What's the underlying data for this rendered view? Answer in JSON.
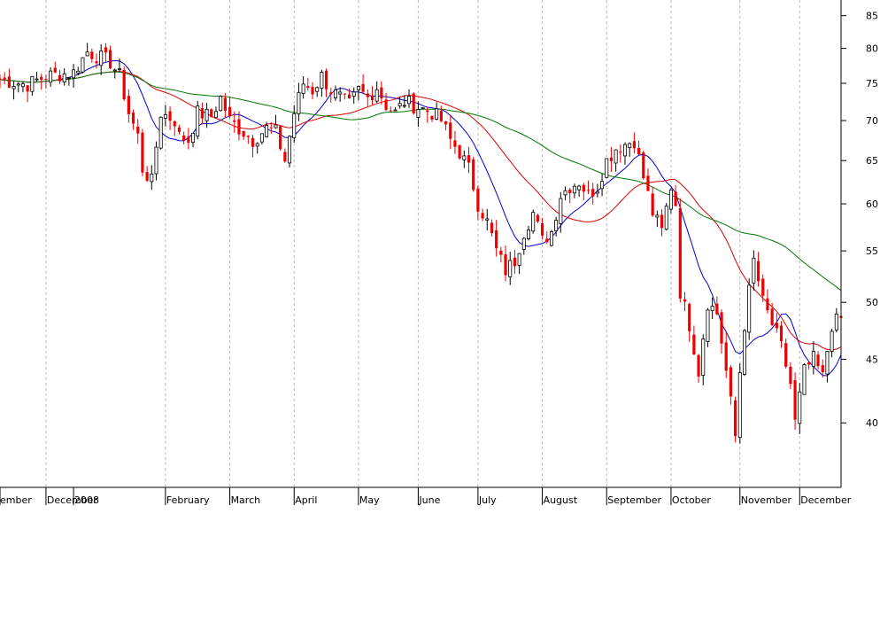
{
  "chart_data": {
    "type": "candlestick",
    "title": "",
    "xlabel": "",
    "ylabel": "",
    "y_scale": "log",
    "ylim": [
      35.5,
      87.5
    ],
    "y_ticks": [
      85,
      80,
      75,
      70,
      65,
      60,
      55,
      50,
      45,
      40
    ],
    "x_tick_labels": [
      "ember",
      "December",
      "2008",
      "February",
      "March",
      "April",
      "May",
      "June",
      "July",
      "August",
      "September",
      "October",
      "November",
      "December"
    ],
    "x_tick_index": [
      0,
      10,
      16,
      36,
      50,
      64,
      78,
      91,
      104,
      118,
      132,
      146,
      161,
      174
    ],
    "x_tick_gridline": [
      false,
      true,
      false,
      true,
      true,
      true,
      true,
      true,
      true,
      true,
      true,
      true,
      true,
      true
    ],
    "n_days": 184,
    "anchors": [
      [
        0,
        75.5
      ],
      [
        6,
        74.8
      ],
      [
        10,
        76
      ],
      [
        16,
        76.5
      ],
      [
        19,
        79.5
      ],
      [
        24,
        78
      ],
      [
        26,
        76
      ],
      [
        28,
        71
      ],
      [
        30,
        68
      ],
      [
        31,
        64
      ],
      [
        33,
        62.5
      ],
      [
        35,
        71
      ],
      [
        38,
        70
      ],
      [
        39,
        68
      ],
      [
        41,
        67.5
      ],
      [
        43,
        71
      ],
      [
        46,
        70.5
      ],
      [
        48,
        73
      ],
      [
        50,
        70
      ],
      [
        52,
        69
      ],
      [
        55,
        67.5
      ],
      [
        58,
        69
      ],
      [
        60,
        68.5
      ],
      [
        62,
        65
      ],
      [
        64,
        71
      ],
      [
        66,
        75
      ],
      [
        68,
        74
      ],
      [
        70,
        76
      ],
      [
        72,
        74
      ],
      [
        74,
        73
      ],
      [
        76,
        72
      ],
      [
        78,
        74
      ],
      [
        80,
        73
      ],
      [
        82,
        74.5
      ],
      [
        84,
        72
      ],
      [
        86,
        71
      ],
      [
        88,
        72.5
      ],
      [
        90,
        72
      ],
      [
        92,
        71.5
      ],
      [
        94,
        71
      ],
      [
        96,
        70
      ],
      [
        98,
        67.5
      ],
      [
        100,
        66
      ],
      [
        102,
        64
      ],
      [
        104,
        60
      ],
      [
        106,
        58
      ],
      [
        108,
        55
      ],
      [
        110,
        53
      ],
      [
        112,
        54
      ],
      [
        114,
        57
      ],
      [
        116,
        59
      ],
      [
        118,
        56
      ],
      [
        120,
        57
      ],
      [
        122,
        61
      ],
      [
        124,
        62
      ],
      [
        126,
        62.5
      ],
      [
        128,
        61
      ],
      [
        130,
        62
      ],
      [
        132,
        65
      ],
      [
        134,
        66.5
      ],
      [
        136,
        67
      ],
      [
        138,
        67.5
      ],
      [
        140,
        63
      ],
      [
        142,
        59
      ],
      [
        144,
        57
      ],
      [
        146,
        62
      ],
      [
        147,
        60
      ],
      [
        148,
        51
      ],
      [
        150,
        48
      ],
      [
        152,
        44
      ],
      [
        154,
        50
      ],
      [
        156,
        49
      ],
      [
        158,
        44
      ],
      [
        160,
        39
      ],
      [
        161,
        44
      ],
      [
        162,
        48
      ],
      [
        164,
        54
      ],
      [
        166,
        50
      ],
      [
        168,
        48
      ],
      [
        170,
        46
      ],
      [
        172,
        43
      ],
      [
        173,
        40
      ],
      [
        175,
        44
      ],
      [
        177,
        45
      ],
      [
        179,
        43.5
      ],
      [
        181,
        48
      ],
      [
        183,
        48.5
      ]
    ],
    "series": [
      {
        "name": "",
        "period": 10,
        "color": "#0000cc"
      },
      {
        "name": "",
        "period": 25,
        "color": "#dd0000"
      },
      {
        "name": "",
        "period": 50,
        "color": "#007700"
      }
    ],
    "colors": {
      "up": "#000000",
      "down": "#ee0000",
      "grid": "#bbbbbb",
      "axis": "#000000"
    },
    "grid": true
  }
}
